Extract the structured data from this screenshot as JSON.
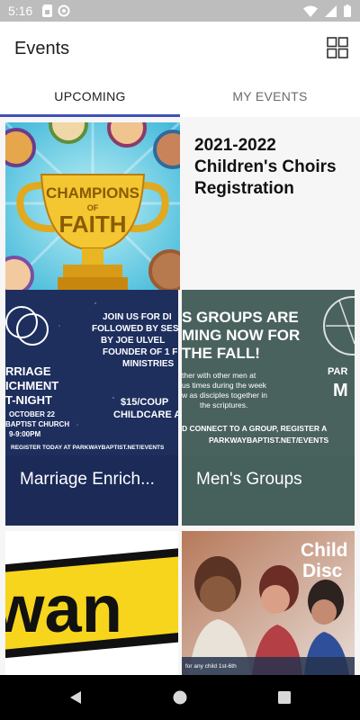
{
  "status_bar": {
    "time": "5:16",
    "left_icons": [
      "sim-card-icon",
      "data-saver-icon"
    ],
    "right_icons": [
      "wifi-icon",
      "signal-icon",
      "battery-icon"
    ]
  },
  "app_bar": {
    "title": "Events",
    "grid_icon": "grid-view-icon"
  },
  "tabs": [
    {
      "label": "UPCOMING",
      "active": true
    },
    {
      "label": "MY EVENTS",
      "active": false
    }
  ],
  "events": [
    {
      "title": "2021-2022 Children's Choirs Registration",
      "image_text": [
        "CHAMPIONS",
        "OF",
        "FAITH"
      ]
    },
    {
      "title": "Marriage Enrich...",
      "image_text": [
        "JOIN US FOR DI",
        "FOLLOWED BY SESS",
        "BY JOE ULVEL",
        "FOUNDER OF 1 F",
        "MINISTRIES",
        "RRIAGE",
        "ICHMENT",
        "T-NIGHT",
        "OCTOBER 22",
        "BAPTIST CHURCH",
        "9-9:00PM",
        "$15/COUP",
        "CHILDCARE AV",
        "REGISTER TODAY AT PARKWAYBAPTIST.NET/EVENTS"
      ]
    },
    {
      "title": "Men's Groups",
      "image_text": [
        "S GROUPS ARE",
        "MING NOW FOR",
        "THE FALL!",
        "ther with other men at",
        "us times during the week",
        "w as disciples together in",
        "the scriptures.",
        "PAR",
        "M",
        "D CONNECT TO A GROUP, REGISTER A",
        "PARKWAYBAPTIST.NET/EVENTS"
      ]
    },
    {
      "title": "",
      "image_text": [
        "wan"
      ]
    },
    {
      "title": "",
      "image_text": [
        "Child",
        "Disc",
        "for any child 1st-6th"
      ]
    }
  ],
  "nav_bar": {
    "icons": [
      "back-icon",
      "home-icon",
      "recents-icon"
    ]
  }
}
